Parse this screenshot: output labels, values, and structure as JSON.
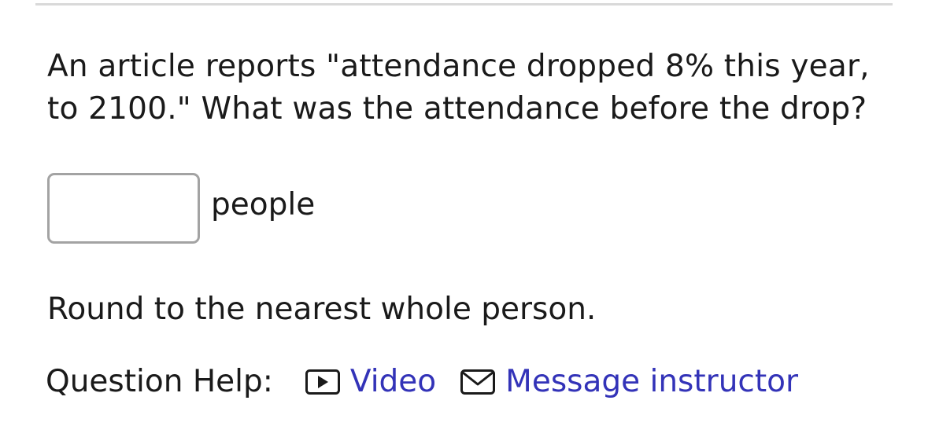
{
  "question": {
    "text": "An article reports \"attendance dropped 8% this year, to 2100.\" What was the attendance before the drop?"
  },
  "answer": {
    "value": "",
    "placeholder": "",
    "unit": "people"
  },
  "instructions": {
    "rounding": "Round to the nearest whole person."
  },
  "help": {
    "label": "Question Help:",
    "links": [
      {
        "label": "Video",
        "icon": "video-icon"
      },
      {
        "label": "Message instructor",
        "icon": "mail-icon"
      }
    ]
  },
  "colors": {
    "link": "#3333b8",
    "text": "#1a1a1a",
    "input_border": "#a3a3a3",
    "rule": "#d9d9d9"
  }
}
